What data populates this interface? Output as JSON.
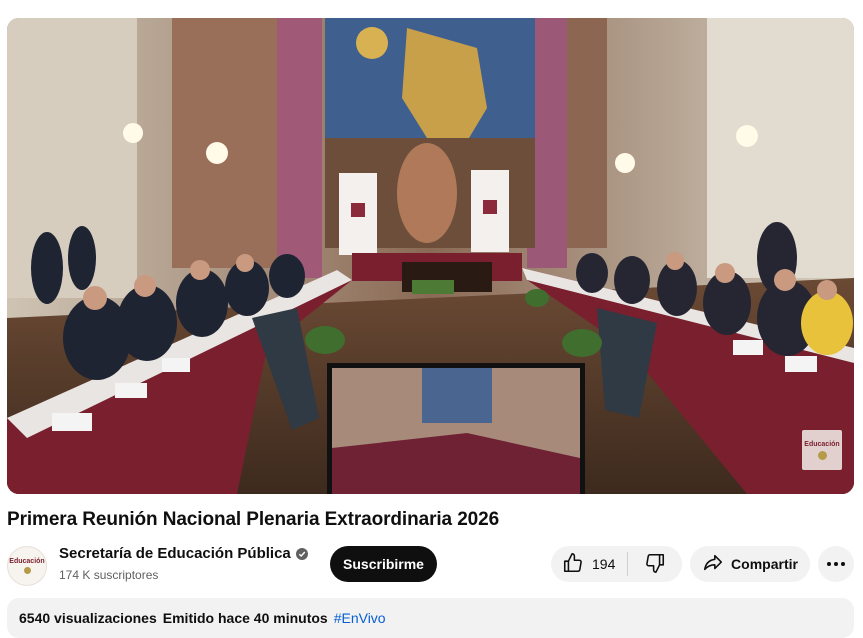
{
  "video": {
    "title": "Primera Reunión Nacional Plenaria Extraordinaria 2026",
    "watermark_text": "Educación"
  },
  "channel": {
    "name": "Secretaría de Educación Pública",
    "subscribers": "174 K suscriptores",
    "avatar_text": "Educación",
    "verified_icon": "check-circle-icon"
  },
  "actions": {
    "subscribe_label": "Suscribirme",
    "like_count": "194",
    "share_label": "Compartir"
  },
  "description": {
    "views": "6540 visualizaciones",
    "streamed": "Emitido hace 40 minutos",
    "hashtag": "#EnVivo"
  },
  "colors": {
    "subscribe_bg": "#0f0f0f",
    "pill_bg": "#f2f2f2",
    "link": "#065fd4",
    "tablecloth": "#7a1f2e"
  }
}
